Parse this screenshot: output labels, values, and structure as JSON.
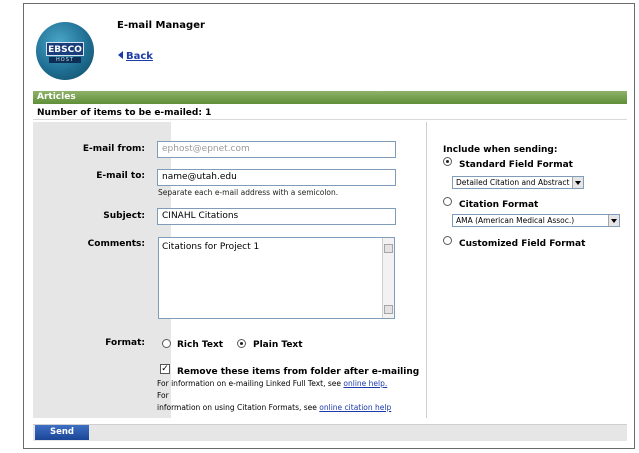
{
  "header": {
    "title": "E-mail Manager",
    "back_label": "Back",
    "logo_text": "EBSCO",
    "logo_subtext": "HOST"
  },
  "section": {
    "label": "Articles",
    "items_count_text": "Number of items to be e-mailed: 1"
  },
  "form": {
    "from_label": "E-mail from:",
    "from_value": "ephost@epnet.com",
    "to_label": "E-mail to:",
    "to_value": "name@utah.edu",
    "to_hint": "Separate each e-mail address with a semicolon.",
    "subject_label": "Subject:",
    "subject_value": "CINAHL Citations",
    "comments_label": "Comments:",
    "comments_value": "Citations for Project 1",
    "format_label": "Format:",
    "rich_text_label": "Rich Text",
    "plain_text_label": "Plain Text",
    "selected_format": "Plain Text",
    "remove_label": "Remove these items from folder after e-mailing",
    "remove_checked": true,
    "note_line1_prefix": "For information on e-mailing Linked Full Text, see ",
    "note_link1": "online help.",
    "note_line1_suffix": " For",
    "note_line2_prefix": "information on using Citation Formats, see ",
    "note_link2": "online citation help"
  },
  "include": {
    "heading": "Include when sending:",
    "standard_label": "Standard Field Format",
    "standard_select": "Detailed Citation and Abstract",
    "citation_label": "Citation Format",
    "citation_select": "AMA (American Medical Assoc.)",
    "custom_label": "Customized Field Format",
    "selected": "Standard Field Format"
  },
  "actions": {
    "send_label": "Send"
  },
  "colors": {
    "green_bar": "#6f9a48",
    "link": "#1c3aa8",
    "send_button": "#1b4596",
    "annotation_arrow": "#e8161b"
  }
}
